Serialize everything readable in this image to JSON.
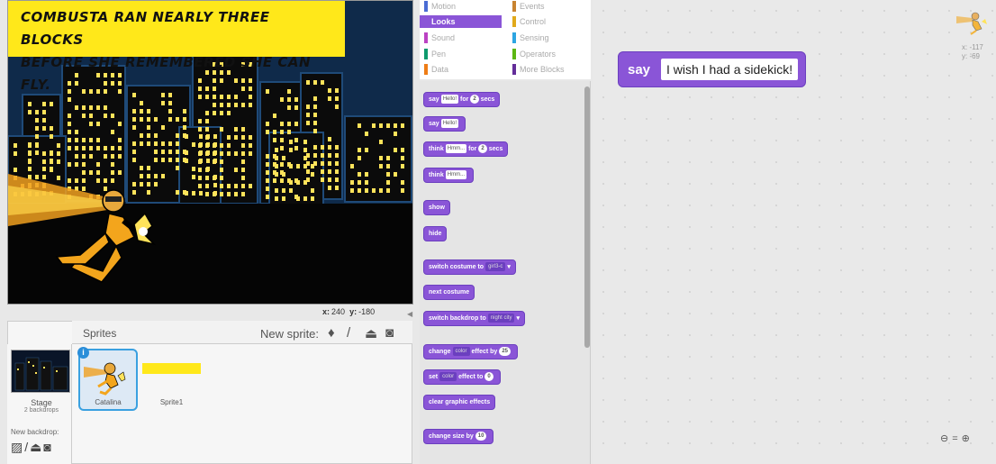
{
  "stage": {
    "caption_line1": "Combusta ran nearly three blocks",
    "caption_line2": "before she remembered she can fly.",
    "coords": {
      "x_label": "x:",
      "x": "240",
      "y_label": "y:",
      "y": "-180"
    }
  },
  "sprites": {
    "header_label": "Sprites",
    "new_sprite_label": "New sprite:",
    "stage_name": "Stage",
    "stage_backdrops": "2 backdrops",
    "new_backdrop_label": "New backdrop:",
    "items": [
      {
        "name": "Catalina"
      },
      {
        "name": "Sprite1"
      }
    ]
  },
  "categories": [
    {
      "label": "Motion",
      "color": "#4a6cd4"
    },
    {
      "label": "Events",
      "color": "#c88330"
    },
    {
      "label": "Looks",
      "color": "#8a55d7",
      "active": true
    },
    {
      "label": "Control",
      "color": "#e1a91a"
    },
    {
      "label": "Sound",
      "color": "#bb42c3"
    },
    {
      "label": "Sensing",
      "color": "#2ca5e2"
    },
    {
      "label": "Pen",
      "color": "#0e9a6c"
    },
    {
      "label": "Operators",
      "color": "#5cb712"
    },
    {
      "label": "Data",
      "color": "#ee7d16"
    },
    {
      "label": "More Blocks",
      "color": "#632d99"
    }
  ],
  "blocks": {
    "say_for": {
      "a": "say",
      "in": "Hello!",
      "b": "for",
      "num": "2",
      "c": "secs"
    },
    "say": {
      "a": "say",
      "in": "Hello!"
    },
    "think_for": {
      "a": "think",
      "in": "Hmm...",
      "b": "for",
      "num": "2",
      "c": "secs"
    },
    "think": {
      "a": "think",
      "in": "Hmm..."
    },
    "show": "show",
    "hide": "hide",
    "switch_costume": {
      "a": "switch costume to",
      "dd": "girl3-c"
    },
    "next_costume": "next costume",
    "switch_backdrop": {
      "a": "switch backdrop to",
      "dd": "night city"
    },
    "change_effect": {
      "a": "change",
      "dd": "color",
      "b": "effect by",
      "num": "25"
    },
    "set_effect": {
      "a": "set",
      "dd": "color",
      "b": "effect to",
      "num": "0"
    },
    "clear_effects": "clear graphic effects",
    "change_size": {
      "a": "change size by",
      "num": "10"
    }
  },
  "script": {
    "say_label": "say",
    "say_text": "I wish I had a sidekick!"
  },
  "sprite_info": {
    "x": "x: -117",
    "y": "y: -69"
  },
  "zoom_icons": [
    "zoom-out-icon",
    "zoom-reset-icon",
    "zoom-in-icon"
  ],
  "colors": {
    "looks": "#8a55d7",
    "caption_bg": "#ffe81a",
    "selection": "#3aa0e0"
  }
}
